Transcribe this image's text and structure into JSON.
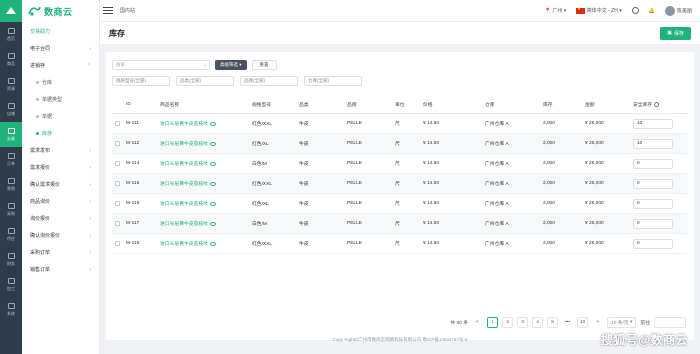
{
  "brand": {
    "name": "数商云"
  },
  "colors": {
    "accent": "#1fb37b",
    "rail": "#2f3a4a"
  },
  "rail": [
    {
      "label": "首页",
      "icon": "home-icon"
    },
    {
      "label": "商品",
      "icon": "goods-icon"
    },
    {
      "label": "资源",
      "icon": "resource-icon"
    },
    {
      "label": "店铺",
      "icon": "shop-icon"
    },
    {
      "label": "交易",
      "icon": "trade-icon",
      "active": true
    },
    {
      "label": "订单",
      "icon": "order-icon"
    },
    {
      "label": "营销",
      "icon": "marketing-icon"
    },
    {
      "label": "采购",
      "icon": "purchase-icon"
    },
    {
      "label": "供应",
      "icon": "supply-icon"
    },
    {
      "label": "财务",
      "icon": "finance-icon"
    },
    {
      "label": "加工",
      "icon": "process-icon"
    },
    {
      "label": "系统",
      "icon": "system-icon"
    }
  ],
  "sidebar": {
    "title": "交易助力",
    "items": [
      {
        "label": "电子合同"
      },
      {
        "label": "进销存"
      },
      {
        "label": "需求发布"
      },
      {
        "label": "需求报价"
      },
      {
        "label": "确认需求报价"
      },
      {
        "label": "商品询价"
      },
      {
        "label": "询价报价"
      },
      {
        "label": "确认询价报价"
      },
      {
        "label": "采购订单"
      },
      {
        "label": "销售订单"
      }
    ],
    "sub_items": [
      {
        "label": "仓库"
      },
      {
        "label": "单据类型"
      },
      {
        "label": "单据"
      },
      {
        "label": "库存",
        "active": true
      }
    ]
  },
  "topbar": {
    "domain": "国内站",
    "location": "广州",
    "language": "简体中文 - ZH",
    "user": "陈美丽"
  },
  "page": {
    "title": "库存",
    "save_label": "保存"
  },
  "filters": {
    "search_placeholder": "搜索",
    "advanced_label": "高级筛选",
    "reset_label": "重置",
    "selects": [
      "规格型号(全部)",
      "品类(全部)",
      "品牌(全部)",
      "仓库(全部)"
    ]
  },
  "table": {
    "headers": [
      "ID",
      "商品名称",
      "规格型号",
      "品类",
      "品牌",
      "单位",
      "价格",
      "仓库",
      "库存",
      "金额",
      "安全库存"
    ],
    "rows": [
      {
        "id": "M-111",
        "name": "进口头层黄牛皮荔枝纹",
        "spec": "红色/XXL",
        "cat": "牛皮",
        "brand": "PELLE",
        "unit": "尺",
        "price": "¥ 14.50",
        "wh": "广州仓库 A",
        "stock": "2,000",
        "amount": "¥ 25,000",
        "safe": "10"
      },
      {
        "id": "M-112",
        "name": "进口头层黄牛皮荔枝纹",
        "spec": "红色/XL",
        "cat": "牛皮",
        "brand": "PELLE",
        "unit": "尺",
        "price": "¥ 14.50",
        "wh": "广州仓库 A",
        "stock": "2,000",
        "amount": "¥ 25,000",
        "safe": "10"
      },
      {
        "id": "M-114",
        "name": "进口头层黄牛皮荔枝纹",
        "spec": "白色/M",
        "cat": "牛皮",
        "brand": "PELLE",
        "unit": "尺",
        "price": "¥ 14.50",
        "wh": "广州仓库 A",
        "stock": "2,000",
        "amount": "¥ 25,000",
        "safe": "0"
      },
      {
        "id": "M-115",
        "name": "进口头层黄牛皮荔枝纹",
        "spec": "红色/XXL",
        "cat": "牛皮",
        "brand": "PELLE",
        "unit": "尺",
        "price": "¥ 14.50",
        "wh": "广州仓库 A",
        "stock": "2,000",
        "amount": "¥ 25,000",
        "safe": "0"
      },
      {
        "id": "M-116",
        "name": "进口头层黄牛皮荔枝纹",
        "spec": "红色/XL",
        "cat": "牛皮",
        "brand": "PELLE",
        "unit": "尺",
        "price": "¥ 14.50",
        "wh": "广州仓库 A",
        "stock": "2,000",
        "amount": "¥ 25,000",
        "safe": "0"
      },
      {
        "id": "M-117",
        "name": "进口头层黄牛皮荔枝纹",
        "spec": "白色/M",
        "cat": "牛皮",
        "brand": "PELLE",
        "unit": "尺",
        "price": "¥ 14.50",
        "wh": "广州仓库 A",
        "stock": "2,000",
        "amount": "¥ 25,000",
        "safe": "0"
      },
      {
        "id": "M-118",
        "name": "进口头层黄牛皮荔枝纹",
        "spec": "红色/XXL",
        "cat": "牛皮",
        "brand": "PELLE",
        "unit": "尺",
        "price": "¥ 14.50",
        "wh": "广州仓库 A",
        "stock": "2,000",
        "amount": "¥ 25,000",
        "safe": "0"
      }
    ]
  },
  "pagination": {
    "total": "共 80 条",
    "prev": "<",
    "pages": [
      "1",
      "2",
      "3",
      "4",
      "5",
      "•••",
      "10"
    ],
    "next": ">",
    "page_size": "10 条/页",
    "goto_label": "前往"
  },
  "footer": "Copy Right©广州市数商云网络科技有限公司 粤ICP备13044767号-5",
  "watermark": "搜狐号@数商云"
}
